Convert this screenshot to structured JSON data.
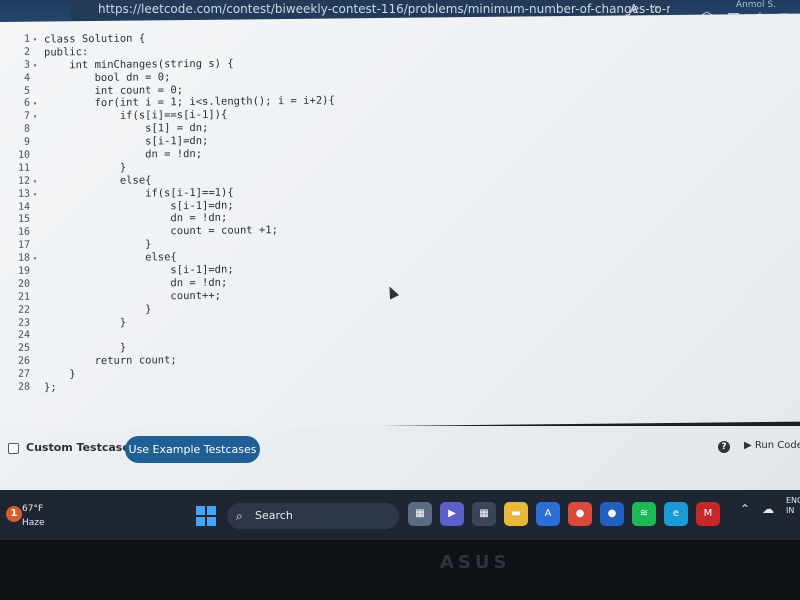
{
  "browser": {
    "url": "https://leetcode.com/contest/biweekly-contest-116/problems/minimum-number-of-changes-to-m...",
    "read_aloud_label": "A",
    "profile_label": "Anmol S."
  },
  "editor": {
    "lines": [
      {
        "n": "1",
        "fold": "▾",
        "code": "class Solution {"
      },
      {
        "n": "2",
        "fold": "",
        "code": "public:"
      },
      {
        "n": "3",
        "fold": "▾",
        "code": "    int minChanges(string s) {"
      },
      {
        "n": "4",
        "fold": "",
        "code": "        bool dn = 0;"
      },
      {
        "n": "5",
        "fold": "",
        "code": "        int count = 0;"
      },
      {
        "n": "6",
        "fold": "▾",
        "code": "        for(int i = 1; i<s.length(); i = i+2){"
      },
      {
        "n": "7",
        "fold": "▾",
        "code": "            if(s[i]==s[i-1]){"
      },
      {
        "n": "8",
        "fold": "",
        "code": "                s[1] = dn;"
      },
      {
        "n": "9",
        "fold": "",
        "code": "                s[i-1]=dn;"
      },
      {
        "n": "10",
        "fold": "",
        "code": "                dn = !dn;"
      },
      {
        "n": "11",
        "fold": "",
        "code": "            }"
      },
      {
        "n": "12",
        "fold": "▾",
        "code": "            else{"
      },
      {
        "n": "13",
        "fold": "▾",
        "code": "                if(s[i-1]==1){"
      },
      {
        "n": "14",
        "fold": "",
        "code": "                    s[i-1]=dn;"
      },
      {
        "n": "15",
        "fold": "",
        "code": "                    dn = !dn;"
      },
      {
        "n": "16",
        "fold": "",
        "code": "                    count = count +1;"
      },
      {
        "n": "17",
        "fold": "",
        "code": "                }"
      },
      {
        "n": "18",
        "fold": "▾",
        "code": "                else{"
      },
      {
        "n": "19",
        "fold": "",
        "code": "                    s[i-1]=dn;"
      },
      {
        "n": "20",
        "fold": "",
        "code": "                    dn = !dn;"
      },
      {
        "n": "21",
        "fold": "",
        "code": "                    count++;"
      },
      {
        "n": "22",
        "fold": "",
        "code": "                }"
      },
      {
        "n": "23",
        "fold": "",
        "code": "            }"
      },
      {
        "n": "24",
        "fold": "",
        "code": ""
      },
      {
        "n": "25",
        "fold": "",
        "code": "            }"
      },
      {
        "n": "26",
        "fold": "",
        "code": "        return count;"
      },
      {
        "n": "27",
        "fold": "",
        "code": "    }"
      },
      {
        "n": "28",
        "fold": "",
        "code": "};"
      }
    ]
  },
  "actions": {
    "custom_testcase_label": "Custom Testcase",
    "example_testcases_label": "Use Example Testcases",
    "help_label": "?",
    "run_label": "▶ Run Code"
  },
  "taskbar": {
    "weather_badge": "1",
    "temperature": "67°F",
    "condition": "Haze",
    "search_label": "Search",
    "lang_top": "ENG",
    "lang_bottom": "IN",
    "apps": [
      {
        "name": "file-explorer-icon",
        "color": "#5a6b82",
        "glyph": "▦"
      },
      {
        "name": "teams-icon",
        "color": "#5b5fc7",
        "glyph": "▶"
      },
      {
        "name": "store-icon",
        "color": "#3a4658",
        "glyph": "▦"
      },
      {
        "name": "folder-icon",
        "color": "#e8b83a",
        "glyph": "▬"
      },
      {
        "name": "app-icon",
        "color": "#2b6fd6",
        "glyph": "A"
      },
      {
        "name": "chrome-icon",
        "color": "#d94a3a",
        "glyph": "●"
      },
      {
        "name": "app-blue-icon",
        "color": "#2060c0",
        "glyph": "●"
      },
      {
        "name": "spotify-icon",
        "color": "#1db954",
        "glyph": "≋"
      },
      {
        "name": "edge-icon",
        "color": "#1a9bd7",
        "glyph": "e"
      },
      {
        "name": "mcafee-icon",
        "color": "#c62828",
        "glyph": "M"
      }
    ]
  },
  "bezel": {
    "brand": "ASUS"
  }
}
